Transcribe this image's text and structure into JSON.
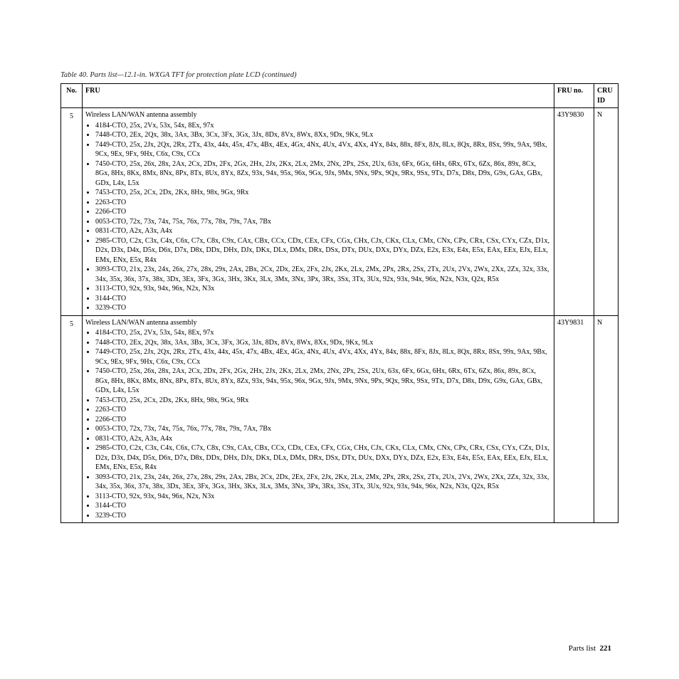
{
  "caption": "Table 40. Parts list—12.1-in. WXGA TFT for protection plate LCD  (continued)",
  "headers": {
    "no": "No.",
    "fru": "FRU",
    "fruno": "FRU no.",
    "cruid": "CRU ID"
  },
  "rows": [
    {
      "no": "5",
      "title": "Wireless LAN/WAN antenna assembly",
      "items": [
        "4184-CTO, 25x, 2Vx, 53x, 54x, 8Ex, 97x",
        "7448-CTO, 2Ex, 2Qx, 38x, 3Ax, 3Bx, 3Cx, 3Fx, 3Gx, 3Jx, 8Dx, 8Vx, 8Wx, 8Xx, 9Dx, 9Kx, 9Lx",
        "7449-CTO, 25x, 2Jx, 2Qx, 2Rx, 2Tx, 43x, 44x, 45x, 47x, 4Bx, 4Ex, 4Gx, 4Nx, 4Ux, 4Vx, 4Xx, 4Yx, 84x, 88x, 8Fx, 8Jx, 8Lx, 8Qx, 8Rx, 8Sx, 99x, 9Ax, 9Bx, 9Cx, 9Ex, 9Fx, 9Hx, C6x, C9x, CCx",
        "7450-CTO, 25x, 26x, 28x, 2Ax, 2Cx, 2Dx, 2Fx, 2Gx, 2Hx, 2Jx, 2Kx, 2Lx, 2Mx, 2Nx, 2Px, 2Sx, 2Ux, 63x, 6Fx, 6Gx, 6Hx, 6Rx, 6Tx, 6Zx, 86x, 89x, 8Cx, 8Gx, 8Hx, 8Kx, 8Mx, 8Nx, 8Px, 8Tx, 8Ux, 8Yx, 8Zx, 93x, 94x, 95x, 96x, 9Gx, 9Jx, 9Mx, 9Nx, 9Px, 9Qx, 9Rx, 9Sx, 9Tx, D7x, D8x, D9x, G9x, GAx, GBx, GDx, L4x, L5x",
        "7453-CTO, 25x, 2Cx, 2Dx, 2Kx, 8Hx, 98x, 9Gx, 9Rx",
        "2263-CTO",
        "2266-CTO",
        "0053-CTO, 72x, 73x, 74x, 75x, 76x, 77x, 78x, 79x, 7Ax, 7Bx",
        "0831-CTO, A2x, A3x, A4x",
        "2985-CTO, C2x, C3x, C4x, C6x, C7x, C8x, C9x, CAx, CBx, CCx, CDx, CEx, CFx, CGx, CHx, CJx, CKx, CLx, CMx, CNx, CPx, CRx, CSx, CYx, CZx, D1x, D2x, D3x, D4x, D5x, D6x, D7x, D8x, DDx, DHx, DJx, DKx, DLx, DMx, DRx, DSx, DTx, DUx, DXx, DYx, DZx, E2x, E3x, E4x, E5x, EAx, EEx, EJx, ELx, EMx, ENx, E5x, R4x",
        "3093-CTO, 21x, 23x, 24x, 26x, 27x, 28x, 29x, 2Ax, 2Bx, 2Cx, 2Dx, 2Ex, 2Fx, 2Jx, 2Kx, 2Lx, 2Mx, 2Px, 2Rx, 2Sx, 2Tx, 2Ux, 2Vx, 2Wx, 2Xx, 2Zx, 32x, 33x, 34x, 35x, 36x, 37x, 38x, 3Dx, 3Ex, 3Fx, 3Gx, 3Hx, 3Kx, 3Lx, 3Mx, 3Nx, 3Px, 3Rx, 3Sx, 3Tx, 3Ux, 92x, 93x, 94x, 96x, N2x, N3x, Q2x, R5x",
        "3113-CTO, 92x, 93x, 94x, 96x, N2x, N3x",
        "3144-CTO",
        "3239-CTO"
      ],
      "fruno": "43Y9830",
      "cruid": "N"
    },
    {
      "no": "5",
      "title": "Wireless LAN/WAN antenna assembly",
      "items": [
        "4184-CTO, 25x, 2Vx, 53x, 54x, 8Ex, 97x",
        "7448-CTO, 2Ex, 2Qx, 38x, 3Ax, 3Bx, 3Cx, 3Fx, 3Gx, 3Jx, 8Dx, 8Vx, 8Wx, 8Xx, 9Dx, 9Kx, 9Lx",
        "7449-CTO, 25x, 2Jx, 2Qx, 2Rx, 2Tx, 43x, 44x, 45x, 47x, 4Bx, 4Ex, 4Gx, 4Nx, 4Ux, 4Vx, 4Xx, 4Yx, 84x, 88x, 8Fx, 8Jx, 8Lx, 8Qx, 8Rx, 8Sx, 99x, 9Ax, 9Bx, 9Cx, 9Ex, 9Fx, 9Hx, C6x, C9x, CCx",
        "7450-CTO, 25x, 26x, 28x, 2Ax, 2Cx, 2Dx, 2Fx, 2Gx, 2Hx, 2Jx, 2Kx, 2Lx, 2Mx, 2Nx, 2Px, 2Sx, 2Ux, 63x, 6Fx, 6Gx, 6Hx, 6Rx, 6Tx, 6Zx, 86x, 89x, 8Cx, 8Gx, 8Hx, 8Kx, 8Mx, 8Nx, 8Px, 8Tx, 8Ux, 8Yx, 8Zx, 93x, 94x, 95x, 96x, 9Gx, 9Jx, 9Mx, 9Nx, 9Px, 9Qx, 9Rx, 9Sx, 9Tx, D7x, D8x, D9x, G9x, GAx, GBx, GDx, L4x, L5x",
        "7453-CTO, 25x, 2Cx, 2Dx, 2Kx, 8Hx, 98x, 9Gx, 9Rx",
        "2263-CTO",
        "2266-CTO",
        "0053-CTO, 72x, 73x, 74x, 75x, 76x, 77x, 78x, 79x, 7Ax, 7Bx",
        "0831-CTO, A2x, A3x, A4x",
        "2985-CTO, C2x, C3x, C4x, C6x, C7x, C8x, C9x, CAx, CBx, CCx, CDx, CEx, CFx, CGx, CHx, CJx, CKx, CLx, CMx, CNx, CPx, CRx, CSx, CYx, CZx, D1x, D2x, D3x, D4x, D5x, D6x, D7x, D8x, DDx, DHx, DJx, DKx, DLx, DMx, DRx, DSx, DTx, DUx, DXx, DYx, DZx, E2x, E3x, E4x, E5x, EAx, EEx, EJx, ELx, EMx, ENx, E5x, R4x",
        "3093-CTO, 21x, 23x, 24x, 26x, 27x, 28x, 29x, 2Ax, 2Bx, 2Cx, 2Dx, 2Ex, 2Fx, 2Jx, 2Kx, 2Lx, 2Mx, 2Px, 2Rx, 2Sx, 2Tx, 2Ux, 2Vx, 2Wx, 2Xx, 2Zx, 32x, 33x, 34x, 35x, 36x, 37x, 38x, 3Dx, 3Ex, 3Fx, 3Gx, 3Hx, 3Kx, 3Lx, 3Mx, 3Nx, 3Px, 3Rx, 3Sx, 3Tx, 3Ux, 92x, 93x, 94x, 96x, N2x, N3x, Q2x, R5x",
        "3113-CTO, 92x, 93x, 94x, 96x, N2x, N3x",
        "3144-CTO",
        "3239-CTO"
      ],
      "fruno": "43Y9831",
      "cruid": "N"
    }
  ],
  "footer": {
    "label": "Parts list",
    "page": "221"
  }
}
